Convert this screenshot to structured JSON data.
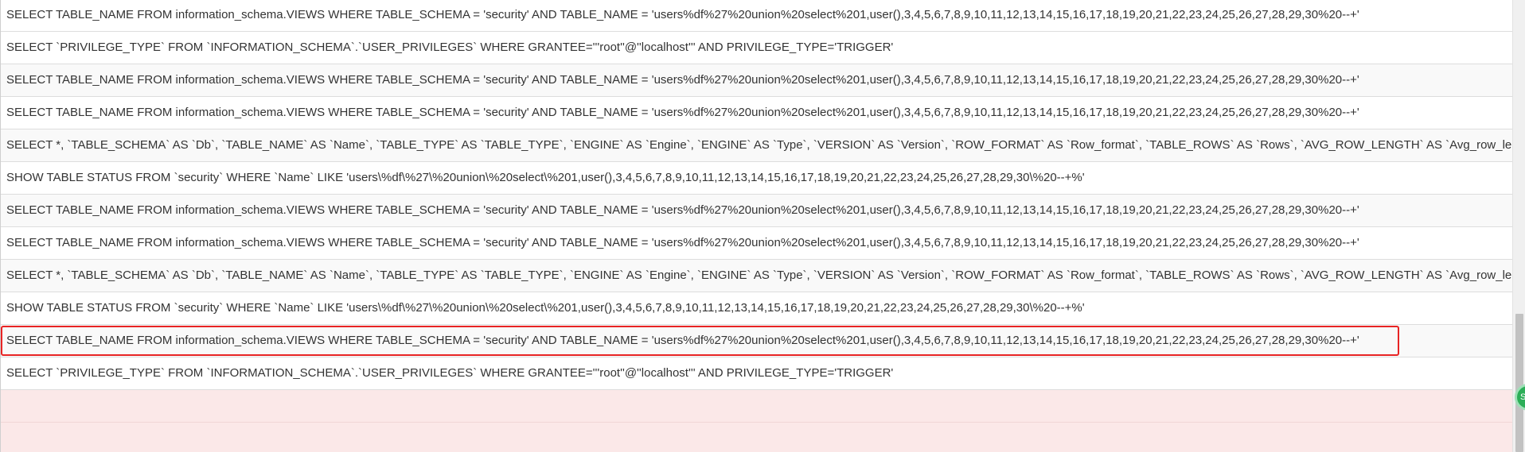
{
  "log": {
    "rows": [
      {
        "sql": "SELECT TABLE_NAME FROM information_schema.VIEWS WHERE TABLE_SCHEMA = 'security' AND TABLE_NAME = 'users%df%27%20union%20select%201,user(),3,4,5,6,7,8,9,10,11,12,13,14,15,16,17,18,19,20,21,22,23,24,25,26,27,28,29,30%20--+'"
      },
      {
        "sql": "SELECT `PRIVILEGE_TYPE` FROM `INFORMATION_SCHEMA`.`USER_PRIVILEGES` WHERE GRANTEE='''root''@''localhost''' AND PRIVILEGE_TYPE='TRIGGER'"
      },
      {
        "sql": "SELECT TABLE_NAME FROM information_schema.VIEWS WHERE TABLE_SCHEMA = 'security' AND TABLE_NAME = 'users%df%27%20union%20select%201,user(),3,4,5,6,7,8,9,10,11,12,13,14,15,16,17,18,19,20,21,22,23,24,25,26,27,28,29,30%20--+'"
      },
      {
        "sql": "SELECT TABLE_NAME FROM information_schema.VIEWS WHERE TABLE_SCHEMA = 'security' AND TABLE_NAME = 'users%df%27%20union%20select%201,user(),3,4,5,6,7,8,9,10,11,12,13,14,15,16,17,18,19,20,21,22,23,24,25,26,27,28,29,30%20--+'"
      },
      {
        "sql": "SELECT *, `TABLE_SCHEMA` AS `Db`, `TABLE_NAME` AS `Name`, `TABLE_TYPE` AS `TABLE_TYPE`, `ENGINE` AS `Engine`, `ENGINE` AS `Type`, `VERSION` AS `Version`, `ROW_FORMAT` AS `Row_format`, `TABLE_ROWS` AS `Rows`, `AVG_ROW_LENGTH` AS `Avg_row_length`, `DATA"
      },
      {
        "sql": "SHOW TABLE STATUS FROM `security` WHERE `Name` LIKE 'users\\%df\\%27\\%20union\\%20select\\%201,user(),3,4,5,6,7,8,9,10,11,12,13,14,15,16,17,18,19,20,21,22,23,24,25,26,27,28,29,30\\%20--+%'"
      },
      {
        "sql": "SELECT TABLE_NAME FROM information_schema.VIEWS WHERE TABLE_SCHEMA = 'security' AND TABLE_NAME = 'users%df%27%20union%20select%201,user(),3,4,5,6,7,8,9,10,11,12,13,14,15,16,17,18,19,20,21,22,23,24,25,26,27,28,29,30%20--+'"
      },
      {
        "sql": "SELECT TABLE_NAME FROM information_schema.VIEWS WHERE TABLE_SCHEMA = 'security' AND TABLE_NAME = 'users%df%27%20union%20select%201,user(),3,4,5,6,7,8,9,10,11,12,13,14,15,16,17,18,19,20,21,22,23,24,25,26,27,28,29,30%20--+'"
      },
      {
        "sql": "SELECT *, `TABLE_SCHEMA` AS `Db`, `TABLE_NAME` AS `Name`, `TABLE_TYPE` AS `TABLE_TYPE`, `ENGINE` AS `Engine`, `ENGINE` AS `Type`, `VERSION` AS `Version`, `ROW_FORMAT` AS `Row_format`, `TABLE_ROWS` AS `Rows`, `AVG_ROW_LENGTH` AS `Avg_row_length`, `DATA"
      },
      {
        "sql": "SHOW TABLE STATUS FROM `security` WHERE `Name` LIKE 'users\\%df\\%27\\%20union\\%20select\\%201,user(),3,4,5,6,7,8,9,10,11,12,13,14,15,16,17,18,19,20,21,22,23,24,25,26,27,28,29,30\\%20--+%'"
      },
      {
        "sql": "SELECT TABLE_NAME FROM information_schema.VIEWS WHERE TABLE_SCHEMA = 'security' AND TABLE_NAME = 'users%df%27%20union%20select%201,user(),3,4,5,6,7,8,9,10,11,12,13,14,15,16,17,18,19,20,21,22,23,24,25,26,27,28,29,30%20--+'",
        "highlighted": true
      },
      {
        "sql": "SELECT `PRIVILEGE_TYPE` FROM `INFORMATION_SCHEMA`.`USER_PRIVILEGES` WHERE GRANTEE='''root''@''localhost''' AND PRIVILEGE_TYPE='TRIGGER'"
      }
    ]
  },
  "float_button": {
    "label": "S"
  },
  "colors": {
    "highlight_border": "#e82424",
    "empty_row_background": "#fbe8e8",
    "float_button": "#2cae58"
  }
}
